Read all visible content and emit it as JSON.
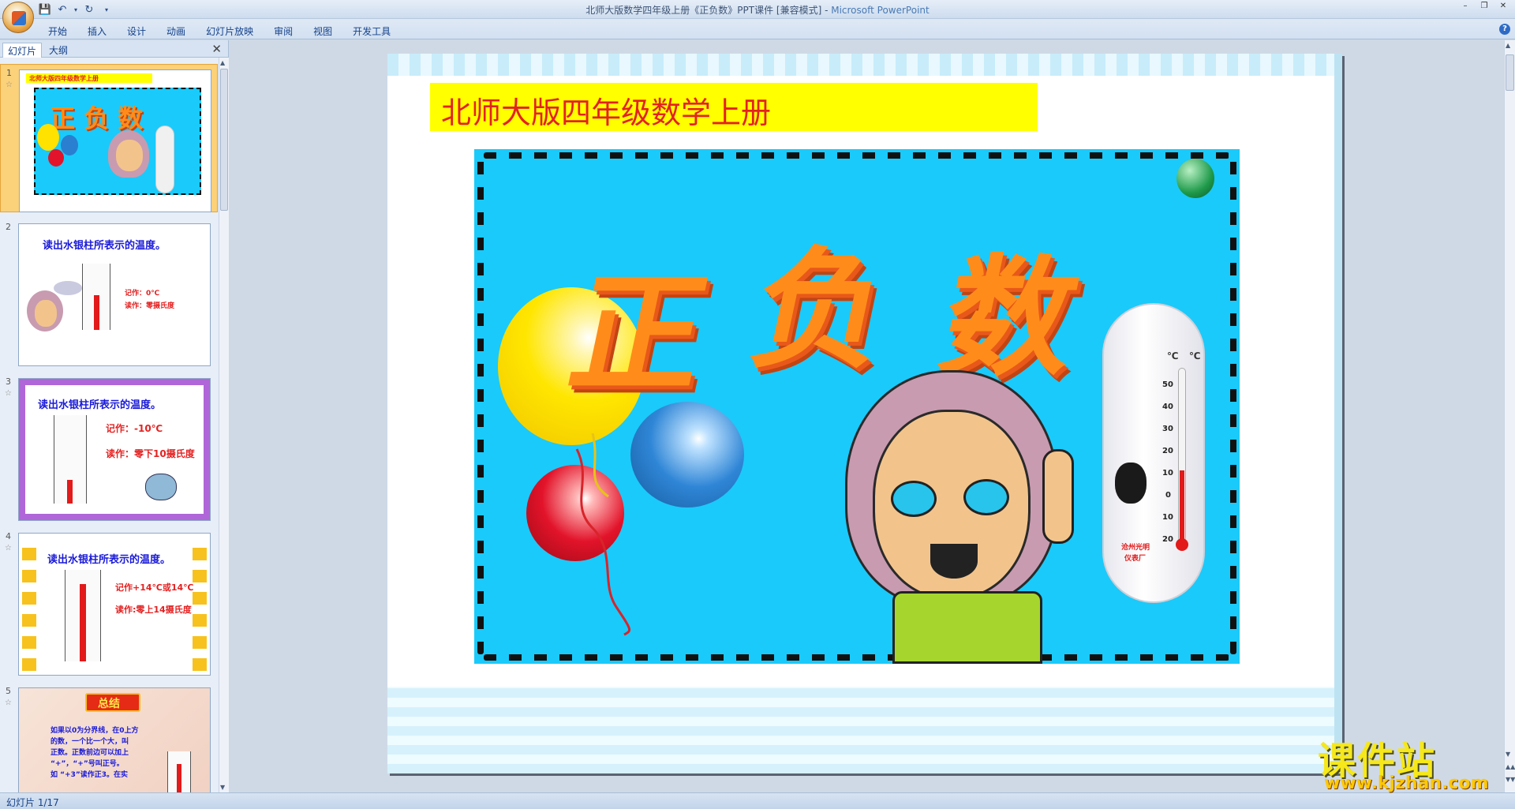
{
  "window": {
    "title": "北师大版数学四年级上册《正负数》PPT课件 [兼容模式] - ",
    "app_name": "Microsoft PowerPoint"
  },
  "ribbon": {
    "tabs": [
      "开始",
      "插入",
      "设计",
      "动画",
      "幻灯片放映",
      "审阅",
      "视图",
      "开发工具"
    ]
  },
  "left_panel": {
    "tabs": [
      "幻灯片",
      "大纲"
    ],
    "slides": [
      {
        "number": "1",
        "header": "北师大版四年级数学上册",
        "chars": "正 负 数"
      },
      {
        "number": "2",
        "title": "读出水银柱所表示的温度。",
        "note1": "记作：0℃",
        "note2": "读作：零摄氏度"
      },
      {
        "number": "3",
        "title": "读出水银柱所表示的温度。",
        "note1": "记作：-10℃",
        "note2": "读作：零下10摄氏度"
      },
      {
        "number": "4",
        "title": "读出水银柱所表示的温度。",
        "note1": "记作+14℃或14℃",
        "note2": "读作:零上14摄氏度"
      },
      {
        "number": "5",
        "title": "总结",
        "lines": [
          "如果以0为分界线，在0上方",
          "的数，一个比一个大，叫",
          "正数。正数前边可以加上",
          "“+”，“+”号叫正号。",
          "如 “+3”读作正3。在实"
        ]
      }
    ]
  },
  "slide": {
    "header": "北师大版四年级数学上册",
    "chars": [
      "正",
      "负",
      "数"
    ],
    "thermometer_units": [
      "℃",
      "℃"
    ],
    "thermometer_scale": [
      "50",
      "40",
      "30",
      "20",
      "10",
      "0",
      "10",
      "20"
    ],
    "thermometer_maker": "沧州光明",
    "thermometer_maker2": "仪表厂"
  },
  "status_bar": {
    "text": "幻灯片 1/17"
  },
  "watermark": {
    "main": "课件站",
    "url": "www.kjzhan.com"
  },
  "colors": {
    "header_bg": "#ffff00",
    "header_text": "#e32222",
    "picture_bg": "#1acafa",
    "chars": "#ff8c1a",
    "selected_thumb": "#fbd17a"
  }
}
